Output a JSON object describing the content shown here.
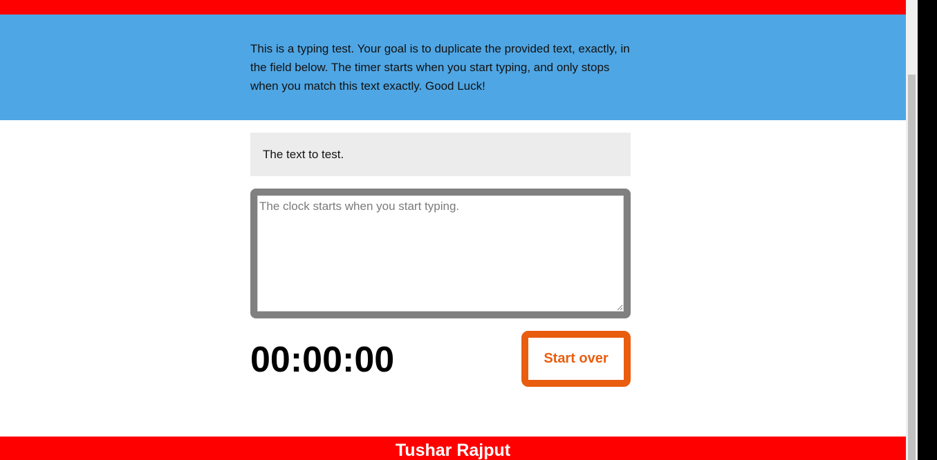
{
  "intro": {
    "text": "This is a typing test. Your goal is to duplicate the provided text, exactly, in the field below. The timer starts when you start typing, and only stops when you match this text exactly. Good Luck!"
  },
  "origin_text": "The text to test.",
  "test_area": {
    "value": "",
    "placeholder": "The clock starts when you start typing."
  },
  "timer": "00:00:00",
  "reset_button": {
    "label": "Start over"
  },
  "footer": {
    "author": "Tushar Rajput"
  },
  "colors": {
    "banner": "#ff0000",
    "intro_bg": "#4fa6e4",
    "origin_bg": "#ececec",
    "wrapper_border": "#808080",
    "accent": "#e95d0f"
  }
}
